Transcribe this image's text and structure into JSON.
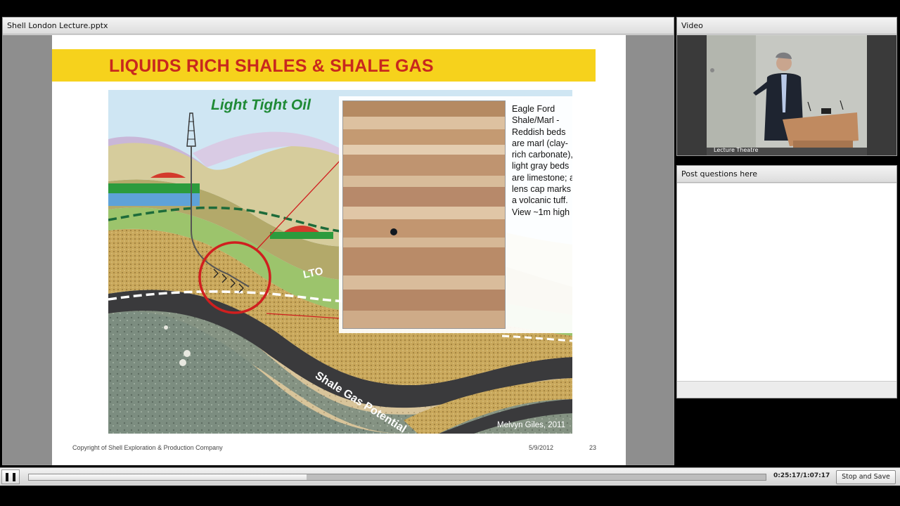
{
  "share_pod": {
    "title": "Shell London Lecture.pptx"
  },
  "slide": {
    "title": "LIQUIDS RICH SHALES & SHALE GAS",
    "figure": {
      "heading": "Light Tight Oil",
      "lto_label": "LTO",
      "shale_gas_label": "Shale Gas Potential",
      "caption": "Eagle Ford Shale/Marl - Reddish beds are marl (clay-rich carbonate), light gray beds are limestone; a lens cap marks a volcanic tuff. View ~1m high",
      "credit": "Melvyn Giles, 2011"
    },
    "footer": {
      "copyright": "Copyright of Shell Exploration & Production Company",
      "date": "5/9/2012",
      "page_number": "23"
    }
  },
  "video_pod": {
    "title": "Video",
    "stream_label": "Lecture  Theatre"
  },
  "qa_pod": {
    "title": "Post questions here"
  },
  "playback": {
    "pause_icon": "pause-icon",
    "elapsed_fraction": 0.377,
    "time_readout": "0:25:17/1:07:17",
    "stop_save_label": "Stop and Save"
  },
  "colors": {
    "title_bar": "#f6d21c",
    "title_text": "#c8281e"
  }
}
